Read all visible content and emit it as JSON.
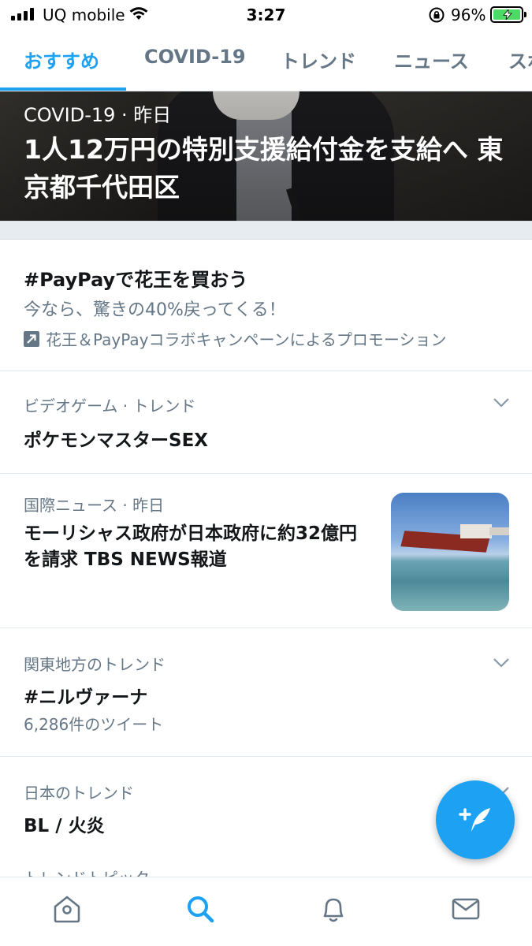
{
  "status_bar": {
    "carrier": "UQ mobile",
    "time": "3:27",
    "battery_percent": "96%",
    "battery_level": 0.96
  },
  "tabs": [
    {
      "label": "おすすめ",
      "active": true
    },
    {
      "label": "COVID-19",
      "active": false
    },
    {
      "label": "トレンド",
      "active": false
    },
    {
      "label": "ニュース",
      "active": false
    },
    {
      "label": "スポ",
      "active": false
    }
  ],
  "hero": {
    "meta": "COVID-19 · 昨日",
    "headline": "1人12万円の特別支援給付金を支給へ 東京都千代田区"
  },
  "promo": {
    "title": "#PayPayで花王を買おう",
    "description": "今なら、驚きの40%戻ってくる！",
    "promoted_by": "花王＆PayPayコラボキャンペーンによるプロモーション"
  },
  "trends": [
    {
      "meta": "ビデオゲーム · トレンド",
      "title": "ポケモンマスターSEX"
    },
    {
      "meta": "国際ニュース · 昨日",
      "title": "モーリシャス政府が日本政府に約32億円を請求 TBS NEWS報道"
    },
    {
      "meta": "関東地方のトレンド",
      "title": "#ニルヴァーナ",
      "tweet_count": "6,286件のツイート"
    },
    {
      "meta": "日本のトレンド",
      "title": "BL / 火炎"
    }
  ],
  "faded_label": "トレンドトピック",
  "colors": {
    "accent": "#1da1f2",
    "secondary_text": "#657786",
    "divider": "#e1e8ed"
  },
  "icons": {
    "nav": [
      "home-icon",
      "search-icon",
      "notifications-icon",
      "messages-icon"
    ],
    "fab": "compose-tweet-icon"
  }
}
